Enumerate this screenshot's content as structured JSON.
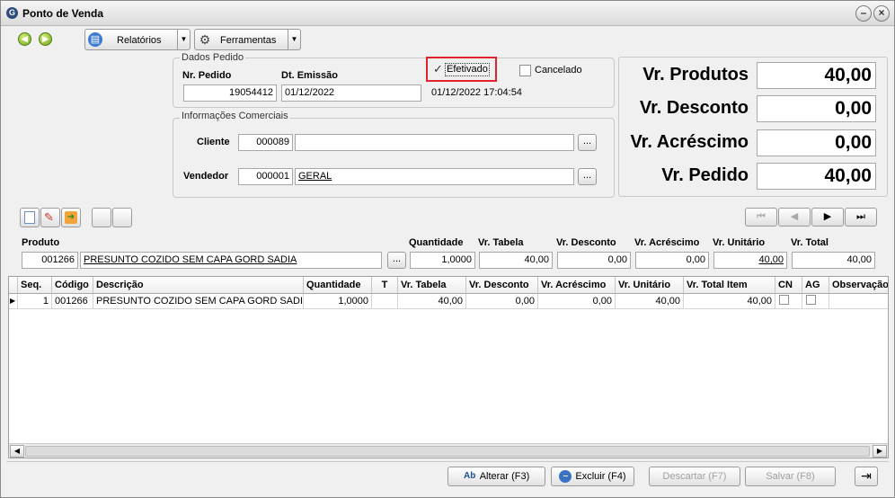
{
  "window": {
    "title": "Ponto de Venda"
  },
  "toolbar": {
    "relatorios_label": "Relatórios",
    "ferramentas_label": "Ferramentas"
  },
  "dados_pedido": {
    "group_title": "Dados Pedido",
    "nr_pedido_label": "Nr. Pedido",
    "nr_pedido": "19054412",
    "dt_emissao_label": "Dt. Emissão",
    "dt_emissao": "01/12/2022",
    "efetivado_label": "Efetivado",
    "cancelado_label": "Cancelado",
    "timestamp": "01/12/2022 17:04:54"
  },
  "info_comerciais": {
    "group_title": "Informações Comerciais",
    "cliente_label": "Cliente",
    "cliente_code": "000089",
    "cliente_name": "",
    "vendedor_label": "Vendedor",
    "vendedor_code": "000001",
    "vendedor_name": "GERAL",
    "lookup_label": "..."
  },
  "totals": {
    "produtos_label": "Vr. Produtos",
    "produtos": "40,00",
    "desconto_label": "Vr. Desconto",
    "desconto": "0,00",
    "acrescimo_label": "Vr. Acréscimo",
    "acrescimo": "0,00",
    "pedido_label": "Vr. Pedido",
    "pedido": "40,00"
  },
  "item_entry": {
    "produto_label": "Produto",
    "produto_code": "001266",
    "produto_desc": "PRESUNTO COZIDO SEM CAPA GORD SADIA",
    "lookup_label": "...",
    "quantidade_label": "Quantidade",
    "quantidade": "1,0000",
    "vr_tabela_label": "Vr. Tabela",
    "vr_tabela": "40,00",
    "vr_desconto_label": "Vr. Desconto",
    "vr_desconto": "0,00",
    "vr_acrescimo_label": "Vr. Acréscimo",
    "vr_acrescimo": "0,00",
    "vr_unitario_label": "Vr. Unitário",
    "vr_unitario": "40,00",
    "vr_total_label": "Vr. Total",
    "vr_total": "40,00"
  },
  "grid": {
    "headers": [
      "Seq.",
      "Código",
      "Descrição",
      "Quantidade",
      "T",
      "Vr. Tabela",
      "Vr. Desconto",
      "Vr. Acréscimo",
      "Vr. Unitário",
      "Vr. Total Item",
      "CN",
      "AG",
      "Observação"
    ],
    "row": {
      "seq": "1",
      "codigo": "001266",
      "descricao": "PRESUNTO COZIDO SEM CAPA GORD SADIA",
      "quantidade": "1,0000",
      "t": "",
      "vr_tabela": "40,00",
      "vr_desconto": "0,00",
      "vr_acrescimo": "0,00",
      "vr_unitario": "40,00",
      "vr_total_item": "40,00",
      "observacao": ""
    }
  },
  "actions": {
    "alterar": "Alterar (F3)",
    "excluir": "Excluir (F4)",
    "descartar": "Descartar (F7)",
    "salvar": "Salvar (F8)"
  },
  "colors": {
    "highlight": "#e0242b",
    "accent": "#2e4c7a",
    "nav_green": "#6ba21a"
  }
}
